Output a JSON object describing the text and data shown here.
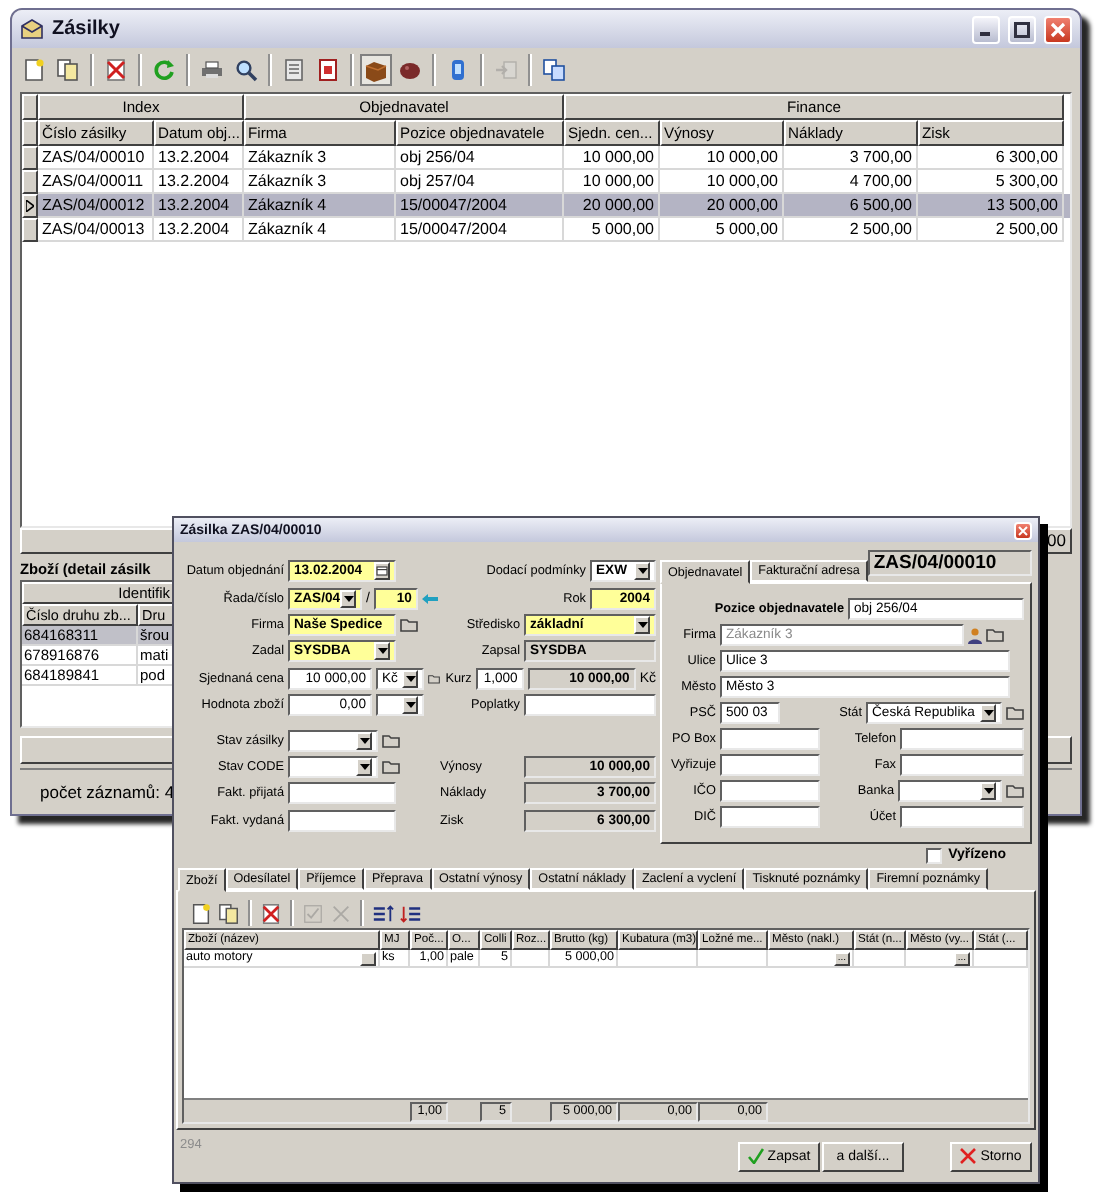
{
  "main_window": {
    "title": "Zásilky"
  },
  "toolbar": [
    {
      "kind": "new",
      "pressed": false,
      "disabled": false
    },
    {
      "kind": "copy",
      "pressed": false,
      "disabled": false
    },
    {
      "kind": "sep"
    },
    {
      "kind": "delete",
      "pressed": false,
      "disabled": false
    },
    {
      "kind": "sep"
    },
    {
      "kind": "refresh",
      "pressed": false,
      "disabled": false
    },
    {
      "kind": "sep"
    },
    {
      "kind": "print",
      "pressed": false,
      "disabled": false
    },
    {
      "kind": "search",
      "pressed": false,
      "disabled": false
    },
    {
      "kind": "sep"
    },
    {
      "kind": "list",
      "pressed": false,
      "disabled": false
    },
    {
      "kind": "report",
      "pressed": false,
      "disabled": false
    },
    {
      "kind": "sep"
    },
    {
      "kind": "box",
      "pressed": true,
      "disabled": false
    },
    {
      "kind": "stone",
      "pressed": false,
      "disabled": false
    },
    {
      "kind": "sep"
    },
    {
      "kind": "bottle",
      "pressed": false,
      "disabled": false
    },
    {
      "kind": "sep"
    },
    {
      "kind": "move",
      "pressed": false,
      "disabled": true
    },
    {
      "kind": "sep"
    },
    {
      "kind": "pages",
      "pressed": false,
      "disabled": false
    }
  ],
  "table": {
    "groups": [
      {
        "label": "Index",
        "columns": [
          {
            "label": "Číslo zásilky",
            "kind": "text"
          },
          {
            "label": "Datum obj...",
            "kind": "text"
          }
        ]
      },
      {
        "label": "Objednavatel",
        "columns": [
          {
            "label": "Firma",
            "kind": "text"
          },
          {
            "label": "Pozice objednavatele",
            "kind": "text"
          }
        ]
      },
      {
        "label": "Finance",
        "columns": [
          {
            "label": "Sjedn. cen...",
            "kind": "number"
          },
          {
            "label": "Výnosy",
            "kind": "number"
          },
          {
            "label": "Náklady",
            "kind": "number"
          },
          {
            "label": "Zisk",
            "kind": "number"
          }
        ]
      }
    ],
    "rows": [
      {
        "selected": false,
        "cells": [
          "ZAS/04/00010",
          "13.2.2004",
          "Zákazník 3",
          "obj 256/04",
          "10 000,00",
          "10 000,00",
          "3 700,00",
          "6 300,00"
        ]
      },
      {
        "selected": false,
        "cells": [
          "ZAS/04/00011",
          "13.2.2004",
          "Zákazník 3",
          "obj 257/04",
          "10 000,00",
          "10 000,00",
          "4 700,00",
          "5 300,00"
        ]
      },
      {
        "selected": true,
        "cells": [
          "ZAS/04/00012",
          "13.2.2004",
          "Zákazník 4",
          "15/00047/2004",
          "20 000,00",
          "20 000,00",
          "6 500,00",
          "13 500,00"
        ]
      },
      {
        "selected": false,
        "cells": [
          "ZAS/04/00013",
          "13.2.2004",
          "Zákazník 4",
          "15/00047/2004",
          "5 000,00",
          "5 000,00",
          "2 500,00",
          "2 500,00"
        ]
      }
    ],
    "summary": "00"
  },
  "detail": {
    "title": "Zboží (detail zásilk",
    "group": "Identifik",
    "columns": [
      "Číslo druhu zb...",
      "Dru"
    ],
    "rows": [
      {
        "selected": true,
        "cells": [
          "684168311",
          "šrou"
        ]
      },
      {
        "selected": false,
        "cells": [
          "678916876",
          "mati"
        ]
      },
      {
        "selected": false,
        "cells": [
          "684189841",
          "pod"
        ]
      }
    ]
  },
  "record_count": "počet záznamů: 4",
  "dialog": {
    "title": "Zásilka ZAS/04/00010",
    "number": "ZAS/04/00010",
    "form_rows": [
      {
        "left": {
          "label": "Datum objednání",
          "kind": "date",
          "value": "13.02.2004",
          "required": true,
          "bold": true
        },
        "right": {
          "label": "Dodací podmínky",
          "kind": "combo",
          "value": "EXW",
          "bold": true
        }
      },
      {
        "left": {
          "label": "Řada/číslo",
          "kind": "series",
          "value": "ZAS/04",
          "separator": "/",
          "number": "10",
          "required": true,
          "bold": true
        },
        "right": {
          "label": "Rok",
          "kind": "number",
          "value": "2004",
          "required": true,
          "bold": true
        }
      },
      {
        "left": {
          "label": "Firma",
          "kind": "text",
          "value": "Naše Spedice",
          "required": true,
          "bold": true,
          "folder": true
        },
        "right": {
          "label": "Středisko",
          "kind": "combo",
          "value": "základní",
          "required": true,
          "bold": true
        }
      },
      {
        "left": {
          "label": "Zadal",
          "kind": "combo",
          "value": "SYSDBA",
          "required": true,
          "bold": true
        },
        "right": {
          "label": "Zapsal",
          "kind": "readonly",
          "value": "SYSDBA",
          "bold": true
        }
      },
      {
        "left": {
          "label": "Sjednaná cena",
          "kind": "amount",
          "value": "10 000,00",
          "currency": "Kč",
          "folder": true
        },
        "right": {
          "label": "Kurz",
          "kind": "rate",
          "value": "1,000",
          "result": "10 000,00",
          "unit": "Kč",
          "bold": true
        }
      },
      {
        "left": {
          "label": "Hodnota zboží",
          "kind": "amount",
          "value": "0,00"
        },
        "right": {
          "label": "Poplatky",
          "kind": "text"
        }
      },
      {
        "left": {
          "label": "Stav zásilky",
          "kind": "combo",
          "folder": true
        }
      },
      {
        "left": {
          "label": "Stav CODE",
          "kind": "combo",
          "folder": true
        },
        "right": {
          "label": "Výnosy",
          "kind": "total",
          "value": "10 000,00",
          "bold": true
        }
      },
      {
        "left": {
          "label": "Fakt. přijatá",
          "kind": "text"
        },
        "right": {
          "label": "Náklady",
          "kind": "total",
          "value": "3 700,00",
          "bold": true
        }
      },
      {
        "left": {
          "label": "Fakt. vydaná",
          "kind": "text"
        },
        "right": {
          "label": "Zisk",
          "kind": "total",
          "value": "6 300,00",
          "bold": true
        }
      }
    ],
    "customer": {
      "tabs": [
        {
          "label": "Objednavatel",
          "selected": true
        },
        {
          "label": "Fakturační adresa",
          "selected": false
        }
      ],
      "rows": [
        {
          "left": {
            "label": "Pozice objednavatele",
            "kind": "heading",
            "value": "obj 256/04"
          }
        },
        {
          "left": {
            "label": "Firma",
            "kind": "disabled",
            "value": "Zákazník 3",
            "person": true,
            "folder": true
          }
        },
        {
          "left": {
            "label": "Ulice",
            "kind": "text",
            "value": "Ulice 3"
          }
        },
        {
          "left": {
            "label": "Město",
            "kind": "text",
            "value": "Město 3"
          }
        },
        {
          "left": {
            "label": "PSČ",
            "kind": "text",
            "value": "500 03"
          },
          "right": {
            "label": "Stát",
            "kind": "combo",
            "value": "Česká Republika",
            "folder": true
          }
        },
        {
          "left": {
            "label": "PO Box",
            "kind": "text"
          },
          "right": {
            "label": "Telefon",
            "kind": "text"
          }
        },
        {
          "left": {
            "label": "Vyřizuje",
            "kind": "text"
          },
          "right": {
            "label": "Fax",
            "kind": "text"
          }
        },
        {
          "left": {
            "label": "IČO",
            "kind": "text"
          },
          "right": {
            "label": "Banka",
            "kind": "combo",
            "folder": true
          }
        },
        {
          "left": {
            "label": "DIČ",
            "kind": "text"
          },
          "right": {
            "label": "Účet",
            "kind": "text"
          }
        }
      ]
    },
    "done": {
      "label": "Vyřízeno",
      "checked": false
    },
    "tabs": [
      {
        "label": "Zboží",
        "selected": true
      },
      {
        "label": "Odesílatel",
        "selected": false
      },
      {
        "label": "Příjemce",
        "selected": false
      },
      {
        "label": "Přeprava",
        "selected": false
      },
      {
        "label": "Ostatní výnosy",
        "selected": false
      },
      {
        "label": "Ostatní náklady",
        "selected": false
      },
      {
        "label": "Zaclení a vyclení",
        "selected": false
      },
      {
        "label": "Tisknuté poznámky",
        "selected": false
      },
      {
        "label": "Firemní poznámky",
        "selected": false
      }
    ],
    "goods_toolbar": [
      {
        "kind": "new",
        "pressed": false,
        "disabled": false
      },
      {
        "kind": "copy",
        "pressed": false,
        "disabled": false
      },
      {
        "kind": "sep"
      },
      {
        "kind": "delete",
        "pressed": false,
        "disabled": false
      },
      {
        "kind": "sep"
      },
      {
        "kind": "check",
        "pressed": false,
        "disabled": true
      },
      {
        "kind": "cross",
        "pressed": false,
        "disabled": true
      },
      {
        "kind": "sep"
      },
      {
        "kind": "row-insert",
        "pressed": false,
        "disabled": false
      },
      {
        "kind": "row-remove",
        "pressed": false,
        "disabled": false
      }
    ],
    "goods": {
      "columns": [
        {
          "label": "Zboží (název)",
          "kind": "text"
        },
        {
          "label": "MJ",
          "kind": "text"
        },
        {
          "label": "Poč...",
          "kind": "number",
          "total": "1,00"
        },
        {
          "label": "O...",
          "kind": "text"
        },
        {
          "label": "Colli",
          "kind": "number",
          "total": "5"
        },
        {
          "label": "Roz...",
          "kind": "text"
        },
        {
          "label": "Brutto (kg)",
          "kind": "number",
          "total": "5 000,00"
        },
        {
          "label": "Kubatura (m3)",
          "kind": "number",
          "total": "0,00"
        },
        {
          "label": "Ložné me...",
          "kind": "number",
          "total": "0,00"
        },
        {
          "label": "Město (nakl.)",
          "kind": "text"
        },
        {
          "label": "Stát (n...",
          "kind": "text"
        },
        {
          "label": "Město (vy...",
          "kind": "text"
        },
        {
          "label": "Stát (...",
          "kind": "text"
        }
      ],
      "rows": [
        {
          "cells": [
            {
              "kind": "picker",
              "text": "auto motory"
            },
            {
              "kind": "text",
              "text": "ks"
            },
            {
              "kind": "text",
              "text": "1,00"
            },
            {
              "kind": "text",
              "text": "pale"
            },
            {
              "kind": "text",
              "text": "5"
            },
            {
              "kind": "blank"
            },
            {
              "kind": "text",
              "text": "5 000,00"
            },
            {
              "kind": "blank"
            },
            {
              "kind": "blank"
            },
            {
              "kind": "lookup",
              "text": "..."
            },
            {
              "kind": "blank"
            },
            {
              "kind": "lookup",
              "text": "..."
            },
            {
              "kind": "blank"
            }
          ]
        }
      ]
    },
    "footer": {
      "note": "294",
      "buttons": [
        {
          "label": "Zapsat",
          "kind": "confirm"
        },
        {
          "label": "a další...",
          "kind": "plain"
        },
        {
          "label": "Storno",
          "kind": "cancel"
        }
      ]
    }
  }
}
